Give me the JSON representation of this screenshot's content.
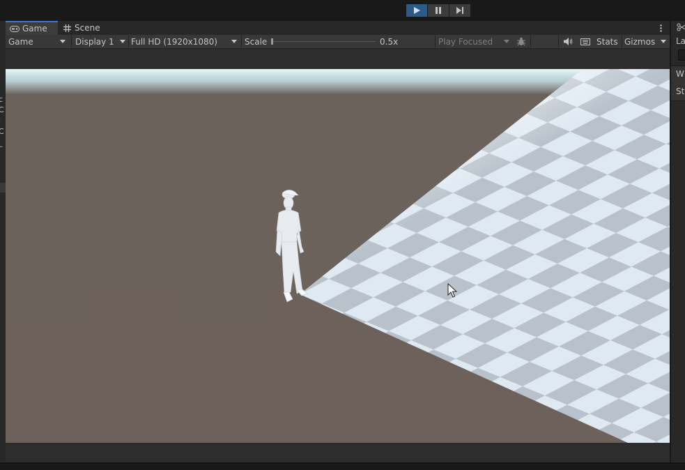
{
  "play_controls": {
    "play": "play-icon",
    "pause": "pause-icon",
    "step": "step-icon"
  },
  "tabs": [
    {
      "label": "Game",
      "icon": "gamepad-icon",
      "active": true
    },
    {
      "label": "Scene",
      "icon": "grid-icon",
      "active": false
    }
  ],
  "toolbar": {
    "mode": "Game",
    "display": "Display 1",
    "resolution": "Full HD (1920x1080)",
    "scale_label": "Scale",
    "scale_value": "0.5x",
    "scale_fraction": 0.0,
    "play_mode": "Play Focused",
    "stats": "Stats",
    "gizmos": "Gizmos"
  },
  "left_panel_fragments": [
    "c",
    "C",
    "l",
    "C",
    "_"
  ],
  "right_panel": {
    "top_label": "La",
    "items": [
      "W",
      "St"
    ]
  },
  "colors": {
    "accent": "#3a7bd5",
    "play_active": "#2d5b88",
    "ground": "#6b615b",
    "sky": "#d7eef2"
  }
}
